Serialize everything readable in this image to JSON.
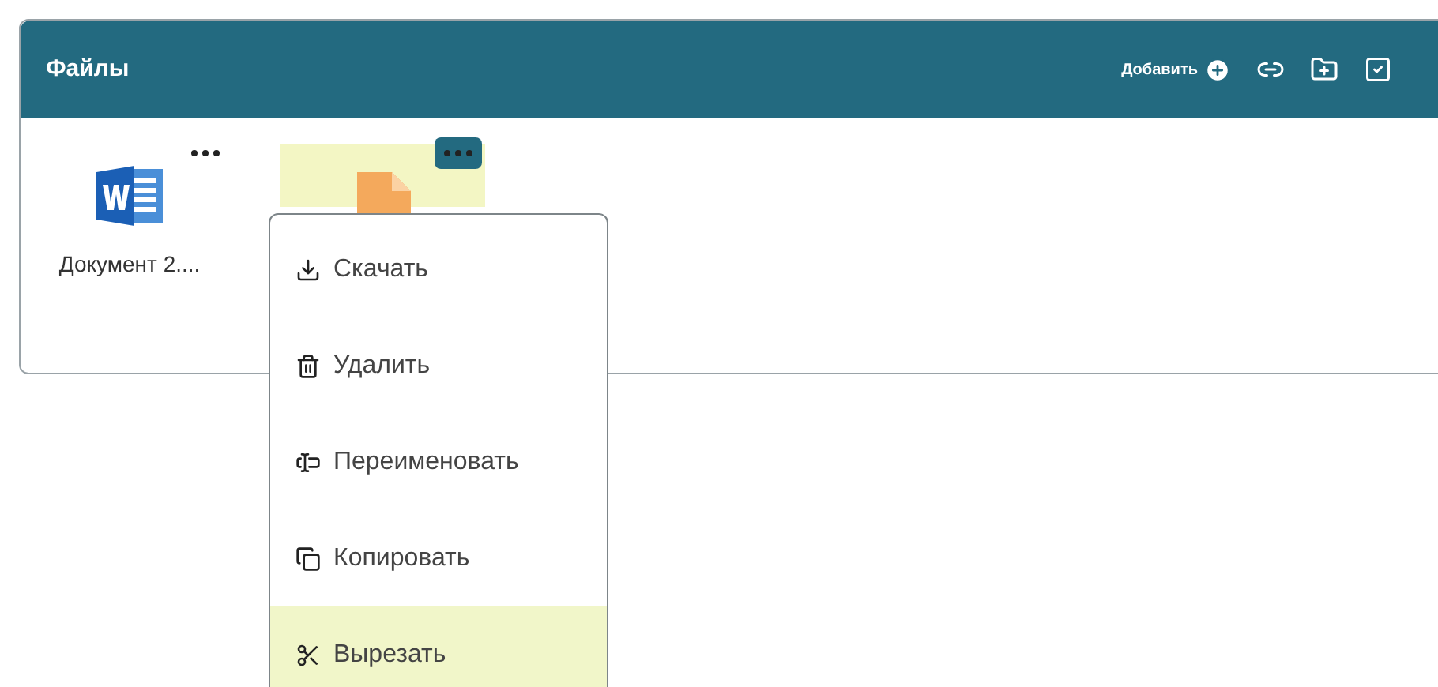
{
  "panel": {
    "title": "Файлы",
    "add_label": "Добавить"
  },
  "files": [
    {
      "kind": "word",
      "name": "Документ 2....",
      "selected": false
    },
    {
      "kind": "generic",
      "selected": true
    }
  ],
  "context_menu": {
    "items": [
      {
        "kind": "download",
        "label": "Скачать",
        "highlighted": false
      },
      {
        "kind": "delete",
        "label": "Удалить",
        "highlighted": false
      },
      {
        "kind": "rename",
        "label": "Переименовать",
        "highlighted": false
      },
      {
        "kind": "copy",
        "label": "Копировать",
        "highlighted": false
      },
      {
        "kind": "cut",
        "label": "Вырезать",
        "highlighted": true
      }
    ]
  }
}
